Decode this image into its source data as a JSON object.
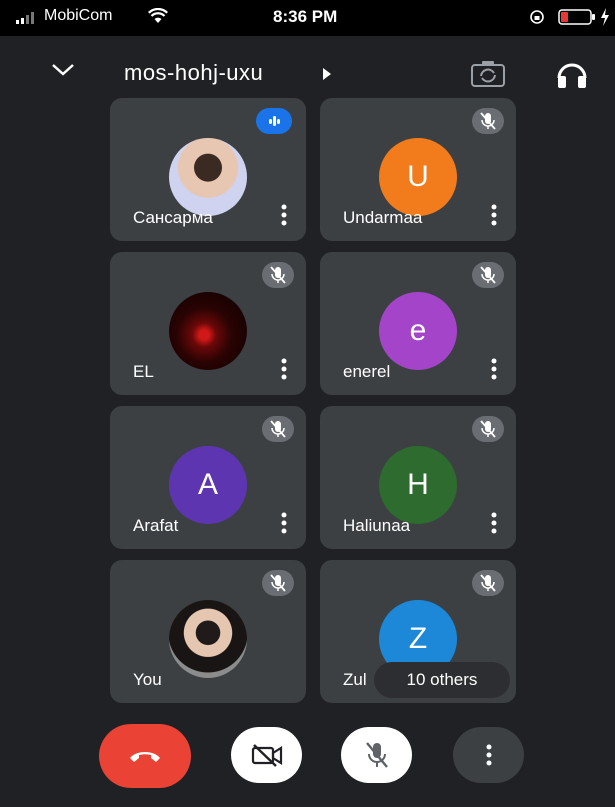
{
  "status_bar": {
    "carrier": "MobiCom",
    "time": "8:36 PM"
  },
  "header": {
    "meeting_code": "mos-hohj-uxu"
  },
  "participants": [
    {
      "name": "Сансарма",
      "avatar_type": "photo",
      "mic": "speaking"
    },
    {
      "name": "Undarmaa",
      "initial": "U",
      "avatar_color": "#f27b1c",
      "mic": "muted"
    },
    {
      "name": "EL",
      "avatar_type": "photo",
      "mic": "muted"
    },
    {
      "name": "enerel",
      "initial": "e",
      "avatar_color": "#a445c9",
      "mic": "muted"
    },
    {
      "name": "Arafat",
      "initial": "A",
      "avatar_color": "#5e35b1",
      "mic": "muted"
    },
    {
      "name": "Haliunaa",
      "initial": "H",
      "avatar_color": "#2e6b2e",
      "mic": "muted"
    },
    {
      "name": "You",
      "avatar_type": "photo",
      "mic": "muted"
    },
    {
      "name": "Zul",
      "initial": "Z",
      "avatar_color": "#1e88d8",
      "mic": "muted"
    }
  ],
  "others_label": "10 others",
  "controls": {
    "end_call_icon": "phone-hangup-icon",
    "camera_icon": "camera-off-icon",
    "mic_icon": "mic-off-icon",
    "more_icon": "more-vertical-icon"
  },
  "colors": {
    "end_call": "#ea4335",
    "speaking": "#1a73e8",
    "tile_bg": "#3c4043",
    "page_bg": "#202124"
  }
}
